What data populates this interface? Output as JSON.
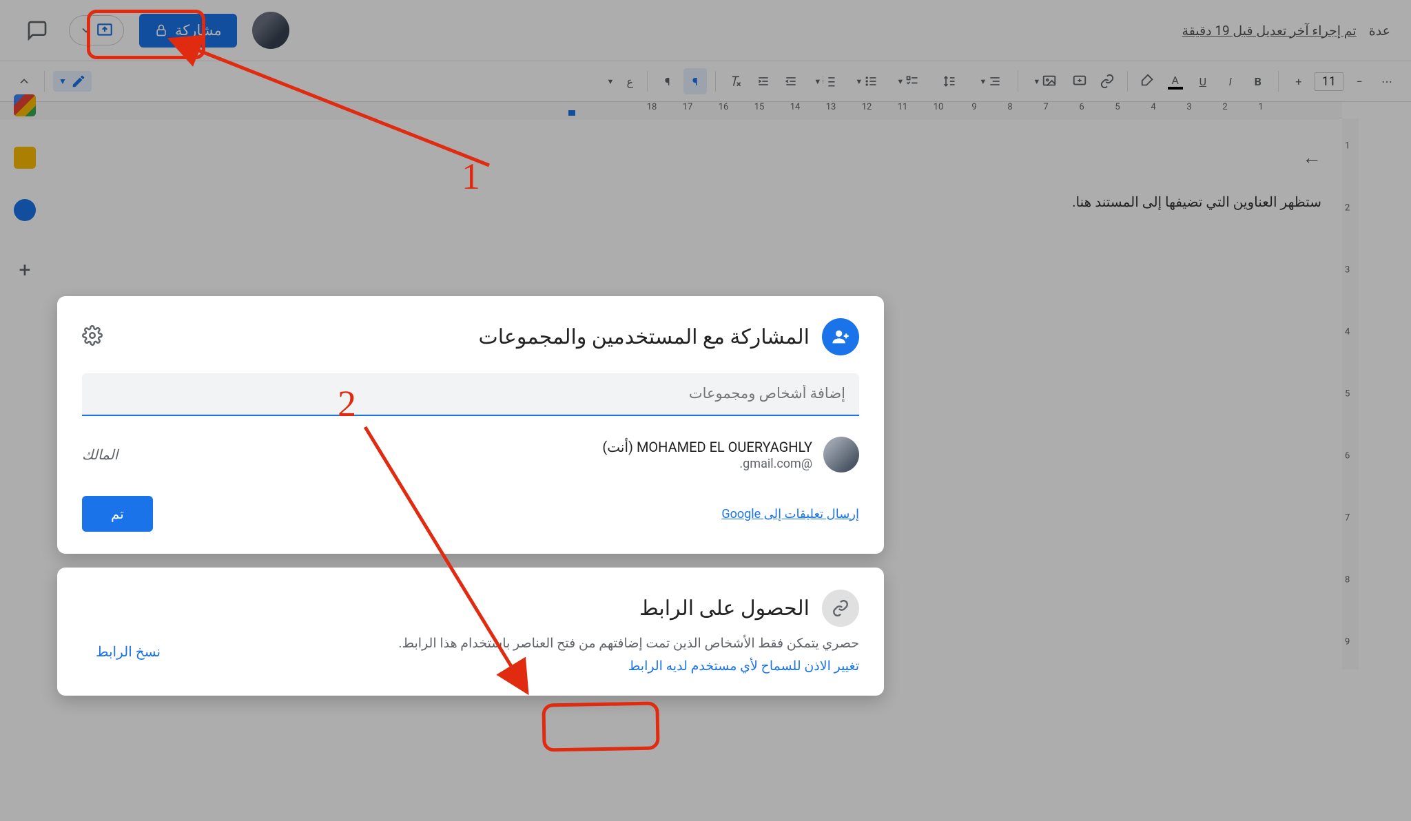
{
  "header": {
    "last_edit": "تم إجراء آخر تعديل قبل 19 دقيقة",
    "help_label": "عدة",
    "share_label": "مشاركة"
  },
  "toolbar": {
    "font_size": "11",
    "format_label": "ع"
  },
  "outline": {
    "placeholder": "ستظهر العناوين التي تضيفها إلى المستند هنا."
  },
  "ruler": {
    "ticks": [
      "1",
      "2",
      "3",
      "4",
      "5",
      "6",
      "7",
      "8",
      "9",
      "10",
      "11",
      "12",
      "13",
      "14",
      "15",
      "16",
      "17",
      "18"
    ]
  },
  "vruler": {
    "ticks": [
      "1",
      "2",
      "3",
      "4",
      "5",
      "6",
      "7",
      "8",
      "9"
    ]
  },
  "dialog": {
    "share_title": "المشاركة مع المستخدمين والمجموعات",
    "add_placeholder": "إضافة أشخاص ومجموعات",
    "person_name": "MOHAMED EL OUERYAGHLY (أنت)",
    "person_email": "@gmail.com.",
    "owner_label": "المالك",
    "feedback": "إرسال تعليقات إلى Google",
    "done": "تم",
    "link_title": "الحصول على الرابط",
    "link_desc": "حصري يتمكن فقط الأشخاص الذين تمت إضافتهم من فتح العناصر باستخدام هذا الرابط.",
    "link_change": "تغيير الاذن للسماح لأي مستخدم لديه الرابط",
    "copy_link": "نسخ الرابط"
  },
  "annotations": {
    "n1": "1",
    "n2": "2"
  }
}
